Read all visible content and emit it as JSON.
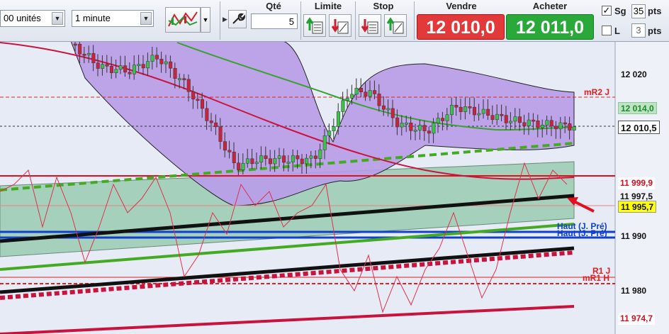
{
  "toolbar": {
    "quantity_combo": "00 unités",
    "interval_combo": "1 minute",
    "qty_label": "Qté",
    "qty_value": "5",
    "limit_label": "Limite",
    "stop_label": "Stop",
    "sell_label": "Vendre",
    "buy_label": "Acheter",
    "sell_price": "12 010,0",
    "buy_price": "12 011,0",
    "sg_label": "Sg",
    "sg_value": "35",
    "sg_checked": true,
    "l_label": "L",
    "l_value": "3",
    "l_checked": false,
    "pts_label": "pts",
    "sell_color": "#e23a3a",
    "buy_color": "#2aa83a"
  },
  "chart": {
    "axis_ticks": [
      "12 020",
      "11 990",
      "11 980"
    ],
    "line_labels": {
      "mr2": "mR2 J",
      "r1": "R1 J",
      "mr1": "mR1 H",
      "haut_j": "Haut (J. Pré)",
      "haut2": "Haut (J. Pré)"
    },
    "price_tags": {
      "ma_green": "12 014,0",
      "last": "12 010,5",
      "red_line": "11 999,9",
      "black_line": "11 997,5",
      "yellow": "11 995,7",
      "bottom": "11 974,7"
    },
    "colors": {
      "band_fill": "#b89ce8",
      "channel_fill": "#8fc8a8",
      "bull": "#3cc24c",
      "bear": "#c8243c"
    }
  }
}
